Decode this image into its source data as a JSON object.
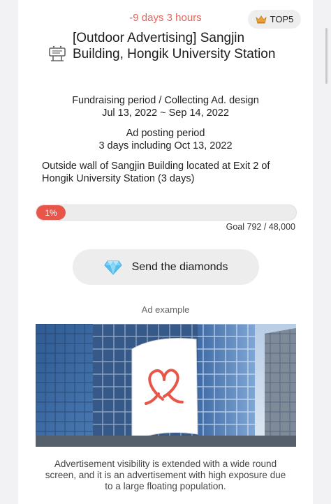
{
  "header": {
    "countdown": "-9 days 3 hours",
    "rank_badge": "TOP5",
    "rank_icon": "crown-icon"
  },
  "campaign": {
    "icon": "billboard-icon",
    "title": "[Outdoor Advertising] Sangjin Building, Hongik University Station",
    "fundraising_label": "Fundraising period / Collecting Ad. design",
    "fundraising_dates": "Jul 13, 2022 ~ Sep 14, 2022",
    "posting_label": "Ad posting period",
    "posting_dates": "3 days including Oct 13, 2022",
    "location": "Outside wall of Sangjin Building located at Exit 2 of Hongik University Station (3 days)"
  },
  "progress": {
    "label": "1%",
    "fraction": 0.01,
    "goal_text": "Goal 792 / 48,000"
  },
  "actions": {
    "send_label": "Send the diamonds",
    "send_icon": "diamond-icon"
  },
  "ad": {
    "example_label": "Ad example",
    "caption": "Advertisement visibility is extended with a wide round screen, and it is an advertisement with high exposure due to a large floating population."
  },
  "colors": {
    "accent": "#e8564a",
    "countdown": "#e2645a"
  }
}
